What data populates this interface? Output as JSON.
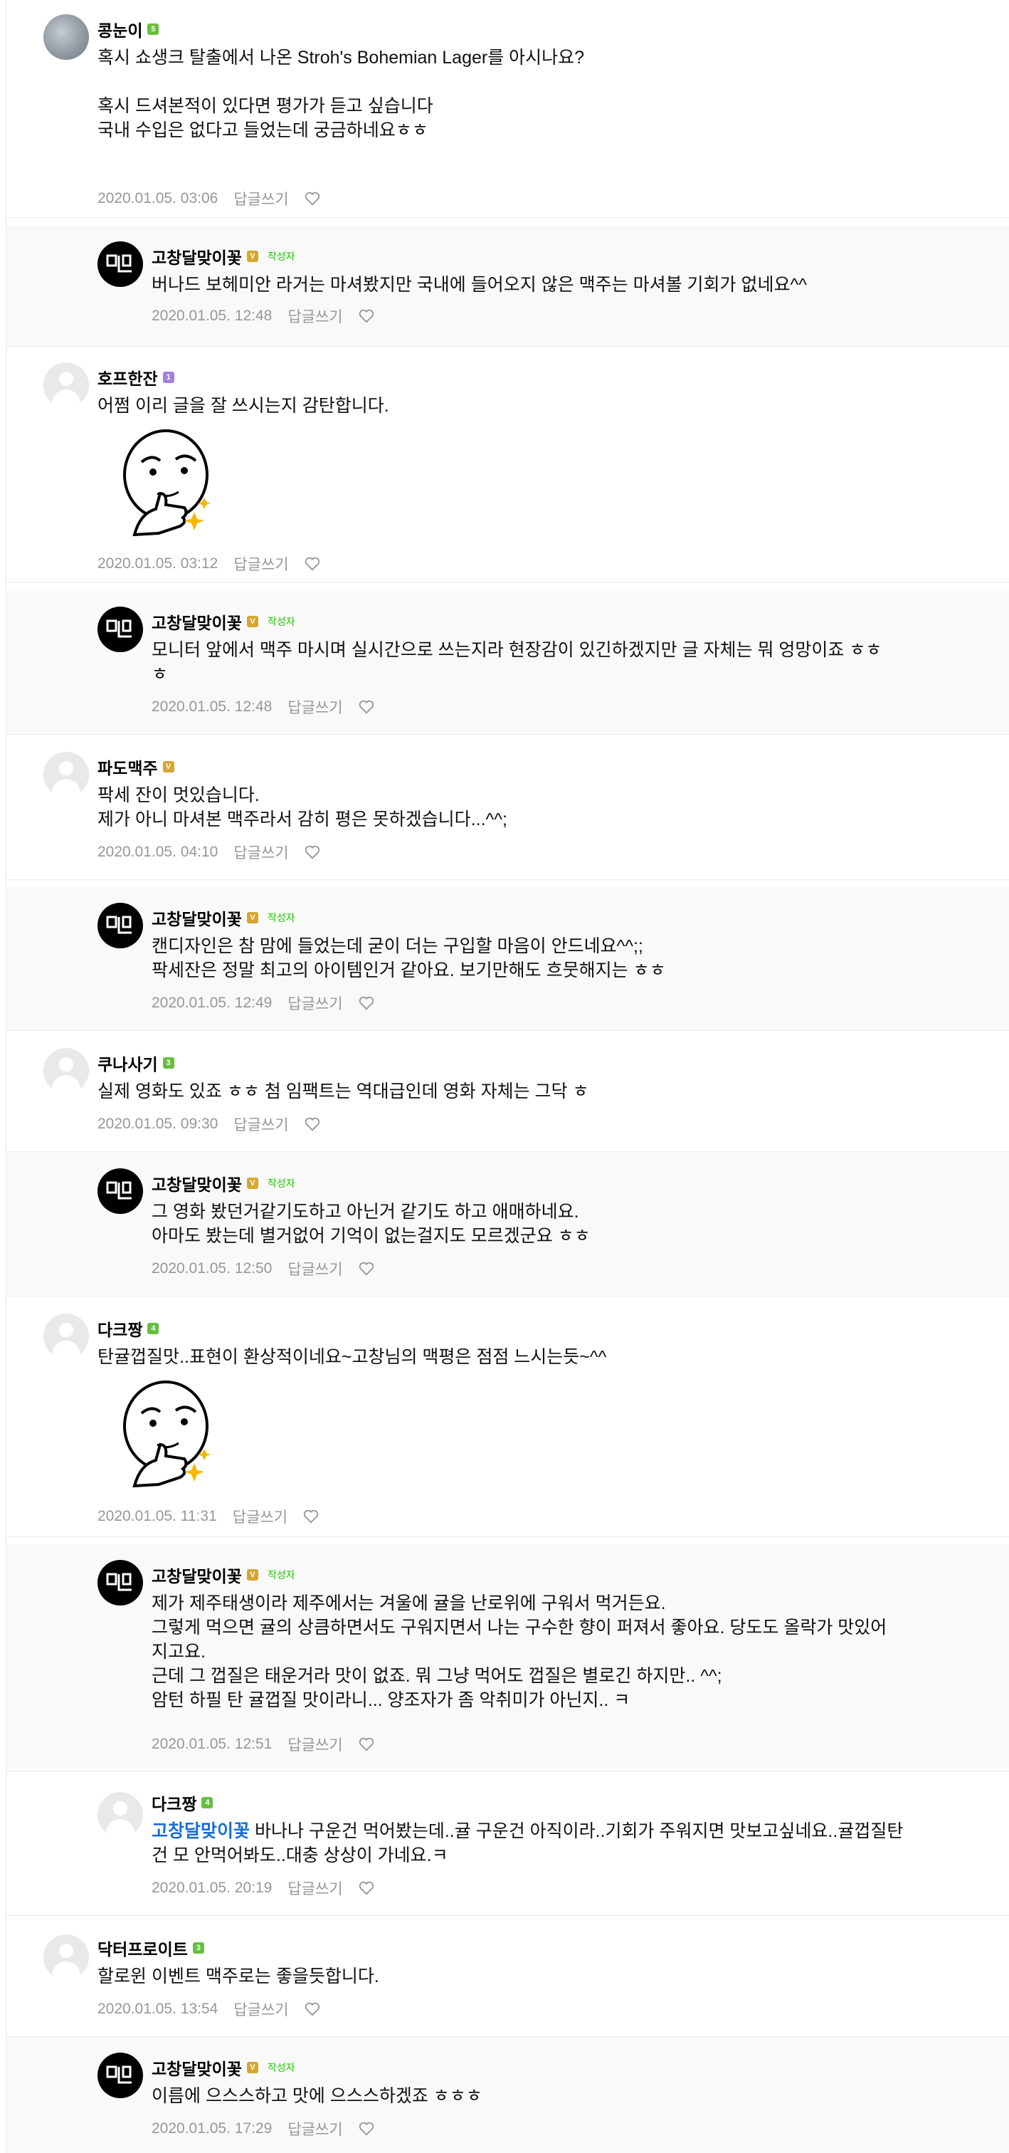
{
  "colors": {
    "owner_badge": "#1ec800",
    "mention": "#1b6fd1",
    "meta": "#979797",
    "reply_bg": "#f9f9f9"
  },
  "comments": [
    {
      "author": "콩눈이",
      "level": "5",
      "text": "혹시 쇼생크 탈출에서 나온 Stroh's Bohemian Lager를 아시나요?\n\n혹시 드셔본적이 있다면 평가가 듣고 싶습니다\n국내 수입은 없다고 들었는데 궁금하네요ㅎㅎ",
      "date": "2020.01.05. 03:06",
      "reply_label": "답글쓰기"
    },
    {
      "author": "고창달맞이꽃",
      "level": "V",
      "owner_badge": "작성자",
      "text": "버나드 보헤미안 라거는 마셔봤지만 국내에 들어오지 않은 맥주는 마셔볼 기회가 없네요^^",
      "date": "2020.01.05. 12:48",
      "reply_label": "답글쓰기"
    },
    {
      "author": "호프한잔",
      "level": "1",
      "text": "어쩜 이리 글을 잘 쓰시는지 감탄합니다.",
      "sticker": "thumbs-up-face",
      "date": "2020.01.05. 03:12",
      "reply_label": "답글쓰기"
    },
    {
      "author": "고창달맞이꽃",
      "level": "V",
      "owner_badge": "작성자",
      "text": "모니터 앞에서 맥주 마시며 실시간으로 쓰는지라 현장감이 있긴하겠지만 글 자체는 뭐 엉망이죠 ㅎㅎ\nㅎ",
      "date": "2020.01.05. 12:48",
      "reply_label": "답글쓰기"
    },
    {
      "author": "파도맥주",
      "level": "V",
      "text": "팍세 잔이 멋있습니다.\n제가 아니 마셔본 맥주라서 감히 평은 못하겠습니다...^^;",
      "date": "2020.01.05. 04:10",
      "reply_label": "답글쓰기"
    },
    {
      "author": "고창달맞이꽃",
      "level": "V",
      "owner_badge": "작성자",
      "text": "캔디자인은 참 맘에 들었는데 굳이 더는 구입할 마음이 안드네요^^;;\n팍세잔은 정말 최고의 아이템인거 같아요. 보기만해도 흐뭇해지는 ㅎㅎ",
      "date": "2020.01.05. 12:49",
      "reply_label": "답글쓰기"
    },
    {
      "author": "쿠나사기",
      "level": "3",
      "text": "실제 영화도 있죠 ㅎㅎ 첨 임팩트는 역대급인데 영화 자체는 그닥 ㅎ",
      "date": "2020.01.05. 09:30",
      "reply_label": "답글쓰기"
    },
    {
      "author": "고창달맞이꽃",
      "level": "V",
      "owner_badge": "작성자",
      "text": "그 영화 봤던거같기도하고 아닌거 같기도 하고 애매하네요.\n아마도 봤는데 별거없어 기억이 없는걸지도 모르겠군요 ㅎㅎ",
      "date": "2020.01.05. 12:50",
      "reply_label": "답글쓰기"
    },
    {
      "author": "다크짱",
      "level": "4",
      "text": "탄귤껍질맛..표현이 환상적이네요~고창님의 맥평은 점점 느시는듯~^^",
      "sticker": "thumbs-up-face",
      "date": "2020.01.05. 11:31",
      "reply_label": "답글쓰기"
    },
    {
      "author": "고창달맞이꽃",
      "level": "V",
      "owner_badge": "작성자",
      "text": "제가 제주태생이라 제주에서는 겨울에 귤을 난로위에 구워서 먹거든요.\n그렇게 먹으면 귤의 상큼하면서도 구워지면서 나는 구수한 향이 퍼져서 좋아요. 당도도 올락가 맛있어\n지고요.\n근데 그 껍질은 태운거라 맛이 없죠. 뭐 그냥 먹어도 껍질은 별로긴 하지만.. ^^;\n암턴 하필 탄 귤껍질 맛이라니... 양조자가 좀 악취미가 아닌지.. ㅋ",
      "date": "2020.01.05. 12:51",
      "reply_label": "답글쓰기"
    },
    {
      "author": "다크짱",
      "level": "4",
      "mention": "고창달맞이꽃",
      "text": "  바나나 구운건 먹어봤는데..귤 구운건 아직이라..기회가 주워지면 맛보고싶네요..귤껍질탄\n건 모 안먹어봐도..대충 상상이 가네요.ㅋ",
      "date": "2020.01.05. 20:19",
      "reply_label": "답글쓰기"
    },
    {
      "author": "닥터프로이트",
      "level": "3",
      "text": "할로윈 이벤트 맥주로는 좋을듯합니다.",
      "date": "2020.01.05. 13:54",
      "reply_label": "답글쓰기"
    },
    {
      "author": "고창달맞이꽃",
      "level": "V",
      "owner_badge": "작성자",
      "text": "이름에 으스스하고 맛에 으스스하겠죠 ㅎㅎㅎ",
      "date": "2020.01.05. 17:29",
      "reply_label": "답글쓰기"
    }
  ]
}
